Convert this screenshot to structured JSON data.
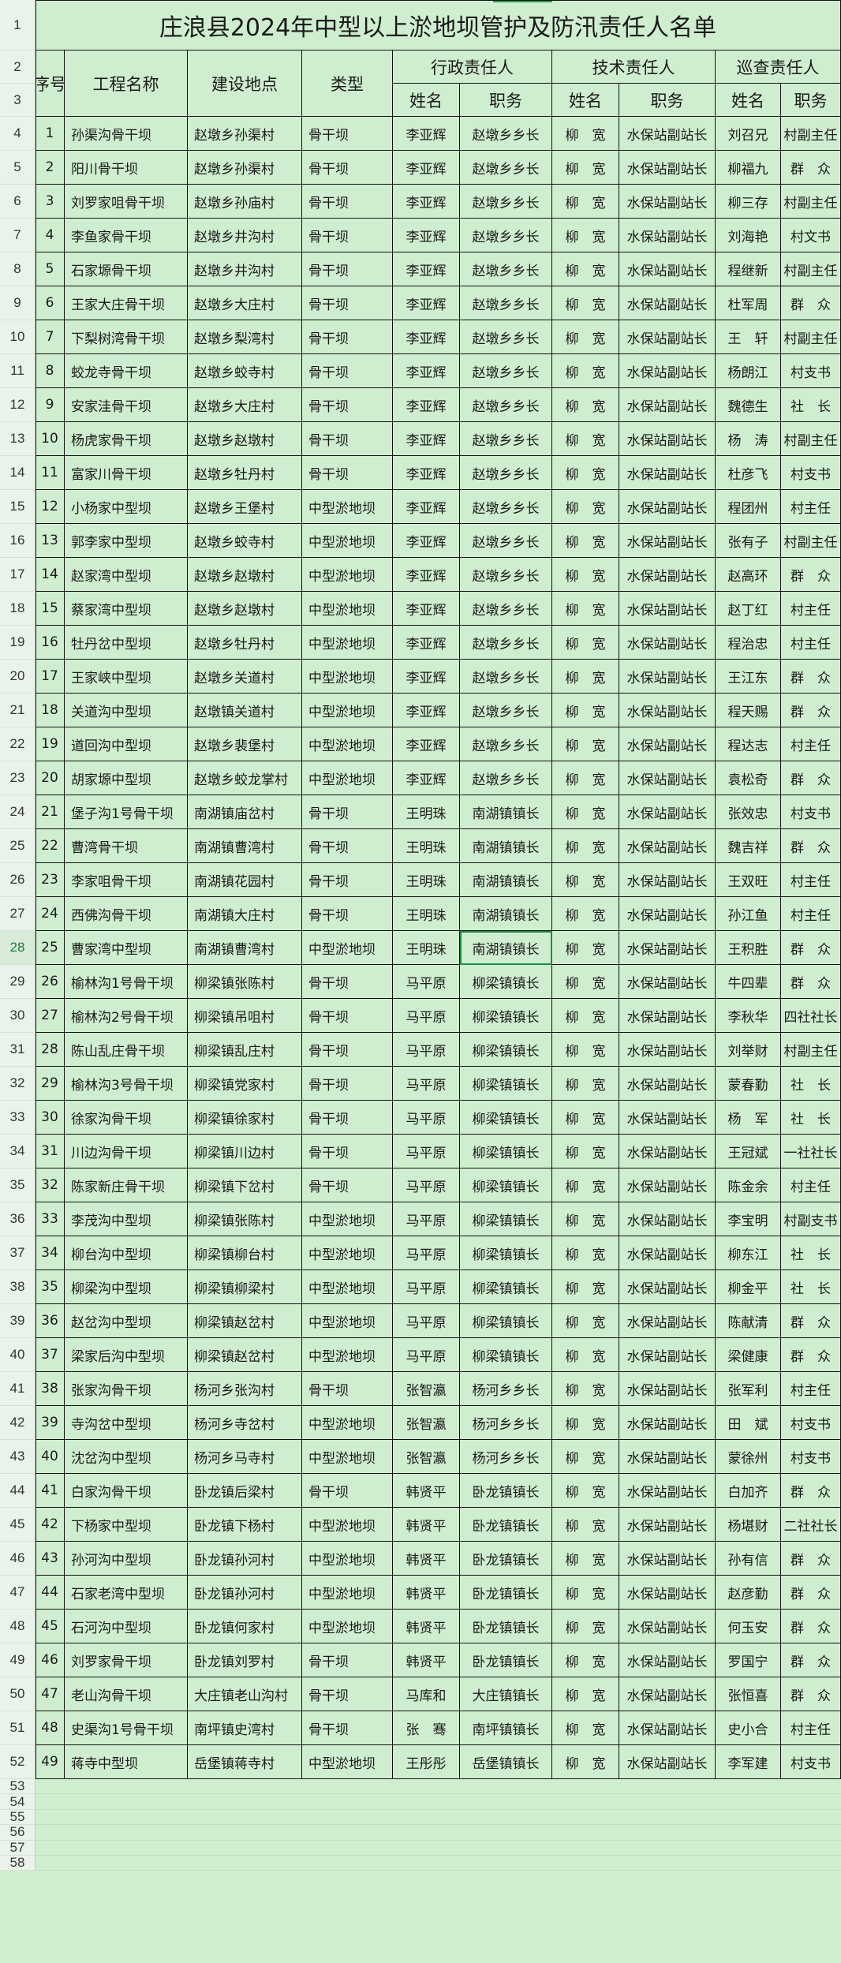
{
  "sheet": {
    "title": "庄浪县2024年中型以上淤地坝管护及防汛责任人名单",
    "headers": {
      "seq": "序号",
      "name": "工程名称",
      "location": "建设地点",
      "type": "类型",
      "admin_group": "行政责任人",
      "tech_group": "技术责任人",
      "patrol_group": "巡查责任人",
      "person": "姓名",
      "position": "职务"
    },
    "row_numbers": [
      1,
      2,
      3,
      4,
      5,
      6,
      7,
      8,
      9,
      10,
      11,
      12,
      13,
      14,
      15,
      16,
      17,
      18,
      19,
      20,
      21,
      22,
      23,
      24,
      25,
      26,
      27,
      28,
      29,
      30,
      31,
      32,
      33,
      34,
      35,
      36,
      37,
      38,
      39,
      40,
      41,
      42,
      43,
      44,
      45,
      46,
      47,
      48,
      49,
      50,
      51,
      52,
      53,
      54,
      55,
      56,
      57,
      58
    ],
    "selected_row": 28,
    "rows": [
      [
        "1",
        "孙渠沟骨干坝",
        "赵墩乡孙渠村",
        "骨干坝",
        "李亚辉",
        "赵墩乡乡长",
        "柳　宽",
        "水保站副站长",
        "刘召兄",
        "村副主任"
      ],
      [
        "2",
        "阳川骨干坝",
        "赵墩乡孙渠村",
        "骨干坝",
        "李亚辉",
        "赵墩乡乡长",
        "柳　宽",
        "水保站副站长",
        "柳福九",
        "群　众"
      ],
      [
        "3",
        "刘罗家咀骨干坝",
        "赵墩乡孙庙村",
        "骨干坝",
        "李亚辉",
        "赵墩乡乡长",
        "柳　宽",
        "水保站副站长",
        "柳三存",
        "村副主任"
      ],
      [
        "4",
        "李鱼家骨干坝",
        "赵墩乡井沟村",
        "骨干坝",
        "李亚辉",
        "赵墩乡乡长",
        "柳　宽",
        "水保站副站长",
        "刘海艳",
        "村文书"
      ],
      [
        "5",
        "石家塬骨干坝",
        "赵墩乡井沟村",
        "骨干坝",
        "李亚辉",
        "赵墩乡乡长",
        "柳　宽",
        "水保站副站长",
        "程继新",
        "村副主任"
      ],
      [
        "6",
        "王家大庄骨干坝",
        "赵墩乡大庄村",
        "骨干坝",
        "李亚辉",
        "赵墩乡乡长",
        "柳　宽",
        "水保站副站长",
        "杜军周",
        "群　众"
      ],
      [
        "7",
        "下梨树湾骨干坝",
        "赵墩乡梨湾村",
        "骨干坝",
        "李亚辉",
        "赵墩乡乡长",
        "柳　宽",
        "水保站副站长",
        "王　轩",
        "村副主任"
      ],
      [
        "8",
        "蛟龙寺骨干坝",
        "赵墩乡蛟寺村",
        "骨干坝",
        "李亚辉",
        "赵墩乡乡长",
        "柳　宽",
        "水保站副站长",
        "杨朗江",
        "村支书"
      ],
      [
        "9",
        "安家洼骨干坝",
        "赵墩乡大庄村",
        "骨干坝",
        "李亚辉",
        "赵墩乡乡长",
        "柳　宽",
        "水保站副站长",
        "魏德生",
        "社　长"
      ],
      [
        "10",
        "杨虎家骨干坝",
        "赵墩乡赵墩村",
        "骨干坝",
        "李亚辉",
        "赵墩乡乡长",
        "柳　宽",
        "水保站副站长",
        "杨　涛",
        "村副主任"
      ],
      [
        "11",
        "富家川骨干坝",
        "赵墩乡牡丹村",
        "骨干坝",
        "李亚辉",
        "赵墩乡乡长",
        "柳　宽",
        "水保站副站长",
        "杜彦飞",
        "村支书"
      ],
      [
        "12",
        "小杨家中型坝",
        "赵墩乡王堡村",
        "中型淤地坝",
        "李亚辉",
        "赵墩乡乡长",
        "柳　宽",
        "水保站副站长",
        "程团州",
        "村主任"
      ],
      [
        "13",
        "郭李家中型坝",
        "赵墩乡蛟寺村",
        "中型淤地坝",
        "李亚辉",
        "赵墩乡乡长",
        "柳　宽",
        "水保站副站长",
        "张有子",
        "村副主任"
      ],
      [
        "14",
        "赵家湾中型坝",
        "赵墩乡赵墩村",
        "中型淤地坝",
        "李亚辉",
        "赵墩乡乡长",
        "柳　宽",
        "水保站副站长",
        "赵高环",
        "群　众"
      ],
      [
        "15",
        "蔡家湾中型坝",
        "赵墩乡赵墩村",
        "中型淤地坝",
        "李亚辉",
        "赵墩乡乡长",
        "柳　宽",
        "水保站副站长",
        "赵丁红",
        "村主任"
      ],
      [
        "16",
        "牡丹岔中型坝",
        "赵墩乡牡丹村",
        "中型淤地坝",
        "李亚辉",
        "赵墩乡乡长",
        "柳　宽",
        "水保站副站长",
        "程治忠",
        "村主任"
      ],
      [
        "17",
        "王家峡中型坝",
        "赵墩乡关道村",
        "中型淤地坝",
        "李亚辉",
        "赵墩乡乡长",
        "柳　宽",
        "水保站副站长",
        "王江东",
        "群　众"
      ],
      [
        "18",
        "关道沟中型坝",
        "赵墩镇关道村",
        "中型淤地坝",
        "李亚辉",
        "赵墩乡乡长",
        "柳　宽",
        "水保站副站长",
        "程天赐",
        "群　众"
      ],
      [
        "19",
        "道回沟中型坝",
        "赵墩乡裴堡村",
        "中型淤地坝",
        "李亚辉",
        "赵墩乡乡长",
        "柳　宽",
        "水保站副站长",
        "程达志",
        "村主任"
      ],
      [
        "20",
        "胡家塬中型坝",
        "赵墩乡蛟龙掌村",
        "中型淤地坝",
        "李亚辉",
        "赵墩乡乡长",
        "柳　宽",
        "水保站副站长",
        "袁松奇",
        "群　众"
      ],
      [
        "21",
        "堡子沟1号骨干坝",
        "南湖镇庙岔村",
        "骨干坝",
        "王明珠",
        "南湖镇镇长",
        "柳　宽",
        "水保站副站长",
        "张效忠",
        "村支书"
      ],
      [
        "22",
        "曹湾骨干坝",
        "南湖镇曹湾村",
        "骨干坝",
        "王明珠",
        "南湖镇镇长",
        "柳　宽",
        "水保站副站长",
        "魏吉祥",
        "群　众"
      ],
      [
        "23",
        "李家咀骨干坝",
        "南湖镇花园村",
        "骨干坝",
        "王明珠",
        "南湖镇镇长",
        "柳　宽",
        "水保站副站长",
        "王双旺",
        "村主任"
      ],
      [
        "24",
        "西佛沟骨干坝",
        "南湖镇大庄村",
        "骨干坝",
        "王明珠",
        "南湖镇镇长",
        "柳　宽",
        "水保站副站长",
        "孙江鱼",
        "村主任"
      ],
      [
        "25",
        "曹家湾中型坝",
        "南湖镇曹湾村",
        "中型淤地坝",
        "王明珠",
        "南湖镇镇长",
        "柳　宽",
        "水保站副站长",
        "王积胜",
        "群　众"
      ],
      [
        "26",
        "榆林沟1号骨干坝",
        "柳梁镇张陈村",
        "骨干坝",
        "马平原",
        "柳梁镇镇长",
        "柳　宽",
        "水保站副站长",
        "牛四辈",
        "群　众"
      ],
      [
        "27",
        "榆林沟2号骨干坝",
        "柳梁镇吊咀村",
        "骨干坝",
        "马平原",
        "柳梁镇镇长",
        "柳　宽",
        "水保站副站长",
        "李秋华",
        "四社社长"
      ],
      [
        "28",
        "陈山乱庄骨干坝",
        "柳梁镇乱庄村",
        "骨干坝",
        "马平原",
        "柳梁镇镇长",
        "柳　宽",
        "水保站副站长",
        "刘举财",
        "村副主任"
      ],
      [
        "29",
        "榆林沟3号骨干坝",
        "柳梁镇党家村",
        "骨干坝",
        "马平原",
        "柳梁镇镇长",
        "柳　宽",
        "水保站副站长",
        "蒙春勤",
        "社　长"
      ],
      [
        "30",
        "徐家沟骨干坝",
        "柳梁镇徐家村",
        "骨干坝",
        "马平原",
        "柳梁镇镇长",
        "柳　宽",
        "水保站副站长",
        "杨　军",
        "社　长"
      ],
      [
        "31",
        "川边沟骨干坝",
        "柳梁镇川边村",
        "骨干坝",
        "马平原",
        "柳梁镇镇长",
        "柳　宽",
        "水保站副站长",
        "王冠斌",
        "一社社长"
      ],
      [
        "32",
        "陈家新庄骨干坝",
        "柳梁镇下岔村",
        "骨干坝",
        "马平原",
        "柳梁镇镇长",
        "柳　宽",
        "水保站副站长",
        "陈金余",
        "村主任"
      ],
      [
        "33",
        "李茂沟中型坝",
        "柳梁镇张陈村",
        "中型淤地坝",
        "马平原",
        "柳梁镇镇长",
        "柳　宽",
        "水保站副站长",
        "李宝明",
        "村副支书"
      ],
      [
        "34",
        "柳台沟中型坝",
        "柳梁镇柳台村",
        "中型淤地坝",
        "马平原",
        "柳梁镇镇长",
        "柳　宽",
        "水保站副站长",
        "柳东江",
        "社　长"
      ],
      [
        "35",
        "柳梁沟中型坝",
        "柳梁镇柳梁村",
        "中型淤地坝",
        "马平原",
        "柳梁镇镇长",
        "柳　宽",
        "水保站副站长",
        "柳金平",
        "社　长"
      ],
      [
        "36",
        "赵岔沟中型坝",
        "柳梁镇赵岔村",
        "中型淤地坝",
        "马平原",
        "柳梁镇镇长",
        "柳　宽",
        "水保站副站长",
        "陈献清",
        "群　众"
      ],
      [
        "37",
        "梁家后沟中型坝",
        "柳梁镇赵岔村",
        "中型淤地坝",
        "马平原",
        "柳梁镇镇长",
        "柳　宽",
        "水保站副站长",
        "梁健康",
        "群　众"
      ],
      [
        "38",
        "张家沟骨干坝",
        "杨河乡张沟村",
        "骨干坝",
        "张智瀛",
        "杨河乡乡长",
        "柳　宽",
        "水保站副站长",
        "张军利",
        "村主任"
      ],
      [
        "39",
        "寺沟岔中型坝",
        "杨河乡寺岔村",
        "中型淤地坝",
        "张智瀛",
        "杨河乡乡长",
        "柳　宽",
        "水保站副站长",
        "田　斌",
        "村支书"
      ],
      [
        "40",
        "沈岔沟中型坝",
        "杨河乡马寺村",
        "中型淤地坝",
        "张智瀛",
        "杨河乡乡长",
        "柳　宽",
        "水保站副站长",
        "蒙徐州",
        "村支书"
      ],
      [
        "41",
        "白家沟骨干坝",
        "卧龙镇后梁村",
        "骨干坝",
        "韩贤平",
        "卧龙镇镇长",
        "柳　宽",
        "水保站副站长",
        "白加齐",
        "群　众"
      ],
      [
        "42",
        "下杨家中型坝",
        "卧龙镇下杨村",
        "中型淤地坝",
        "韩贤平",
        "卧龙镇镇长",
        "柳　宽",
        "水保站副站长",
        "杨堪财",
        "二社社长"
      ],
      [
        "43",
        "孙河沟中型坝",
        "卧龙镇孙河村",
        "中型淤地坝",
        "韩贤平",
        "卧龙镇镇长",
        "柳　宽",
        "水保站副站长",
        "孙有信",
        "群　众"
      ],
      [
        "44",
        "石家老湾中型坝",
        "卧龙镇孙河村",
        "中型淤地坝",
        "韩贤平",
        "卧龙镇镇长",
        "柳　宽",
        "水保站副站长",
        "赵彦勤",
        "群　众"
      ],
      [
        "45",
        "石河沟中型坝",
        "卧龙镇何家村",
        "中型淤地坝",
        "韩贤平",
        "卧龙镇镇长",
        "柳　宽",
        "水保站副站长",
        "何玉安",
        "群　众"
      ],
      [
        "46",
        "刘罗家骨干坝",
        "卧龙镇刘罗村",
        "骨干坝",
        "韩贤平",
        "卧龙镇镇长",
        "柳　宽",
        "水保站副站长",
        "罗国宁",
        "群　众"
      ],
      [
        "47",
        "老山沟骨干坝",
        "大庄镇老山沟村",
        "骨干坝",
        "马库和",
        "大庄镇镇长",
        "柳　宽",
        "水保站副站长",
        "张恒喜",
        "群　众"
      ],
      [
        "48",
        "史渠沟1号骨干坝",
        "南坪镇史湾村",
        "骨干坝",
        "张　骞",
        "南坪镇镇长",
        "柳　宽",
        "水保站副站长",
        "史小合",
        "村主任"
      ],
      [
        "49",
        "蒋寺中型坝",
        "岳堡镇蒋寺村",
        "中型淤地坝",
        "王彤彤",
        "岳堡镇镇长",
        "柳　宽",
        "水保站副站长",
        "李军建",
        "村支书"
      ]
    ]
  }
}
